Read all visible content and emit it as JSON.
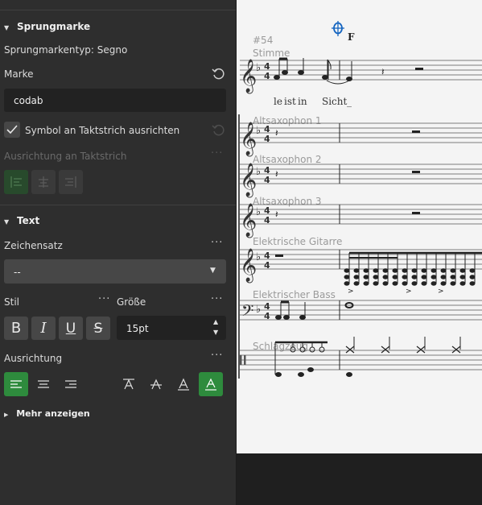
{
  "jump": {
    "section_title": "Sprungmarke",
    "type_text": "Sprungmarkentyp: Segno",
    "marke_label": "Marke",
    "marke_value": "codab",
    "checkbox_label": "Symbol an Taktstrich ausrichten",
    "align_label": "Ausrichtung an Taktstrich"
  },
  "text": {
    "section_title": "Text",
    "font_label": "Zeichensatz",
    "font_value": "--",
    "style_label": "Stil",
    "size_label": "Größe",
    "size_value": "15pt",
    "bold_label": "B",
    "italic_label": "I",
    "underline_label": "U",
    "strike_label": "S",
    "align_label": "Ausrichtung",
    "more_label": "Mehr anzeigen"
  },
  "score": {
    "measure_number": "#54",
    "coda_letter": "F",
    "lyrics": [
      "le",
      "ist",
      "in",
      "Sicht",
      "_"
    ],
    "staves": [
      "Stimme",
      "Altsaxophon 1",
      "Altsaxophon 2",
      "Altsaxophon 3",
      "Elektrische Gitarre",
      "Elektrischer Bass",
      "Schlagzeug"
    ]
  },
  "colors": {
    "accent": "#2e8b3d",
    "panel": "#2e2e2e",
    "paper": "#f4f4f4",
    "coda": "#1565c0"
  }
}
